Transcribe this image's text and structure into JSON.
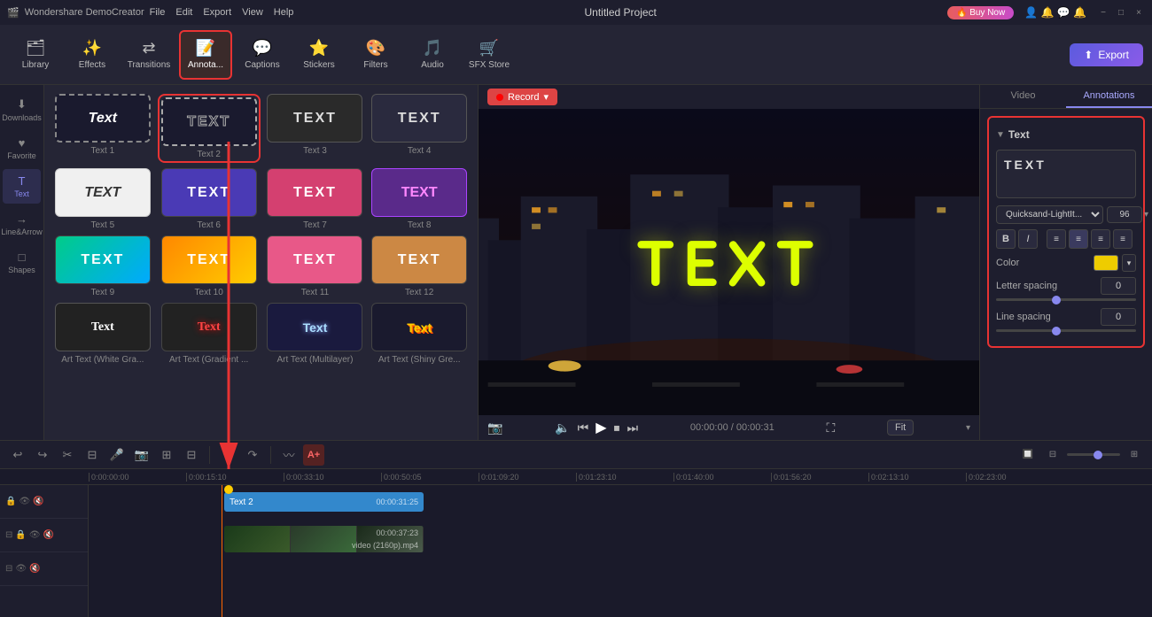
{
  "app": {
    "title": "Wondershare DemoCreator",
    "project_name": "Untitled Project"
  },
  "titlebar": {
    "menu": [
      "File",
      "Edit",
      "Export",
      "View",
      "Help"
    ],
    "win_buttons": [
      "−",
      "□",
      "×"
    ]
  },
  "toolbar": {
    "tools": [
      {
        "id": "library",
        "label": "Library",
        "icon": "🗂"
      },
      {
        "id": "effects",
        "label": "Effects",
        "icon": "✨"
      },
      {
        "id": "transitions",
        "label": "Transitions",
        "icon": "⇄"
      },
      {
        "id": "annotations",
        "label": "Annota...",
        "icon": "📝",
        "active": true
      },
      {
        "id": "captions",
        "label": "Captions",
        "icon": "💬"
      },
      {
        "id": "stickers",
        "label": "Stickers",
        "icon": "⭐"
      },
      {
        "id": "filters",
        "label": "Filters",
        "icon": "🎨"
      },
      {
        "id": "audio",
        "label": "Audio",
        "icon": "🎵"
      },
      {
        "id": "sfx_store",
        "label": "SFX Store",
        "icon": "🛒"
      }
    ],
    "export_label": "Export"
  },
  "left_panel": {
    "items": [
      {
        "id": "downloads",
        "label": "Downloads",
        "icon": "⬇"
      },
      {
        "id": "favorite",
        "label": "Favorite",
        "icon": "♥"
      },
      {
        "id": "text",
        "label": "Text",
        "icon": "T",
        "active": true
      },
      {
        "id": "line_arrow",
        "label": "Line&Arrow",
        "icon": "→"
      },
      {
        "id": "shapes",
        "label": "Shapes",
        "icon": "□"
      }
    ]
  },
  "text_items": [
    {
      "id": 1,
      "label": "Text 1",
      "style": "ts1",
      "text": "Text"
    },
    {
      "id": 2,
      "label": "Text 2",
      "style": "ts2",
      "text": "TEXT"
    },
    {
      "id": 3,
      "label": "Text 3",
      "style": "ts3",
      "text": "TEXT"
    },
    {
      "id": 4,
      "label": "Text 4",
      "style": "ts4",
      "text": "TEXT"
    },
    {
      "id": 5,
      "label": "Text 5",
      "style": "ts5",
      "text": "TEXT"
    },
    {
      "id": 6,
      "label": "Text 6",
      "style": "ts6",
      "text": "TEXT"
    },
    {
      "id": 7,
      "label": "Text 7",
      "style": "ts7",
      "text": "TEXT"
    },
    {
      "id": 8,
      "label": "Text 8",
      "style": "ts8",
      "text": "TEXT"
    },
    {
      "id": 9,
      "label": "Text 9",
      "style": "ts9",
      "text": "TEXT"
    },
    {
      "id": 10,
      "label": "Text 10",
      "style": "ts10",
      "text": "TEXT"
    },
    {
      "id": 11,
      "label": "Text 11",
      "style": "ts11",
      "text": "TEXT"
    },
    {
      "id": 12,
      "label": "Text 12",
      "style": "ts12",
      "text": "TEXT"
    },
    {
      "id": 13,
      "label": "Art Text (White Gra...",
      "style": "ts-art1",
      "text": "Text"
    },
    {
      "id": 14,
      "label": "Art Text (Gradient ...",
      "style": "ts-art2",
      "text": "Text"
    },
    {
      "id": 15,
      "label": "Art Text (Multilayer)",
      "style": "ts-art3",
      "text": "Text"
    },
    {
      "id": 16,
      "label": "Art Text (Shiny Gre...",
      "style": "ts-art4",
      "text": "Text"
    }
  ],
  "preview": {
    "record_label": "Record",
    "text_overlay": "TEXT",
    "time_current": "00:00:00",
    "time_total": "00:00:31",
    "fit_label": "Fit"
  },
  "right_panel": {
    "tabs": [
      "Video",
      "Annotations"
    ],
    "active_tab": "Annotations",
    "section": {
      "title": "Text",
      "text_value": "TEXT",
      "font_name": "Quicksand-LightIt...",
      "font_size": "96",
      "color_label": "Color",
      "letter_spacing_label": "Letter spacing",
      "letter_spacing_value": "0",
      "line_spacing_label": "Line spacing",
      "line_spacing_value": "0"
    }
  },
  "timeline": {
    "ruler_times": [
      "0:00:00:00",
      "0:00:15:10",
      "0:00:33:10",
      "0:00:50:05",
      "0:01:09:20",
      "0:01:23:10",
      "0:01:40:00",
      "0:01:56:20",
      "0:02:13:10",
      "0:02:23:00"
    ],
    "tracks": [
      {
        "type": "text",
        "label": "Text 2",
        "start_time": "00:00:31:25",
        "color": "#3388cc"
      },
      {
        "type": "video",
        "label": "video (2160p).mp4",
        "start_time": "00:00:37:23"
      }
    ],
    "track_icons": [
      "⟲",
      "🔒",
      "👁",
      "🔇"
    ]
  }
}
